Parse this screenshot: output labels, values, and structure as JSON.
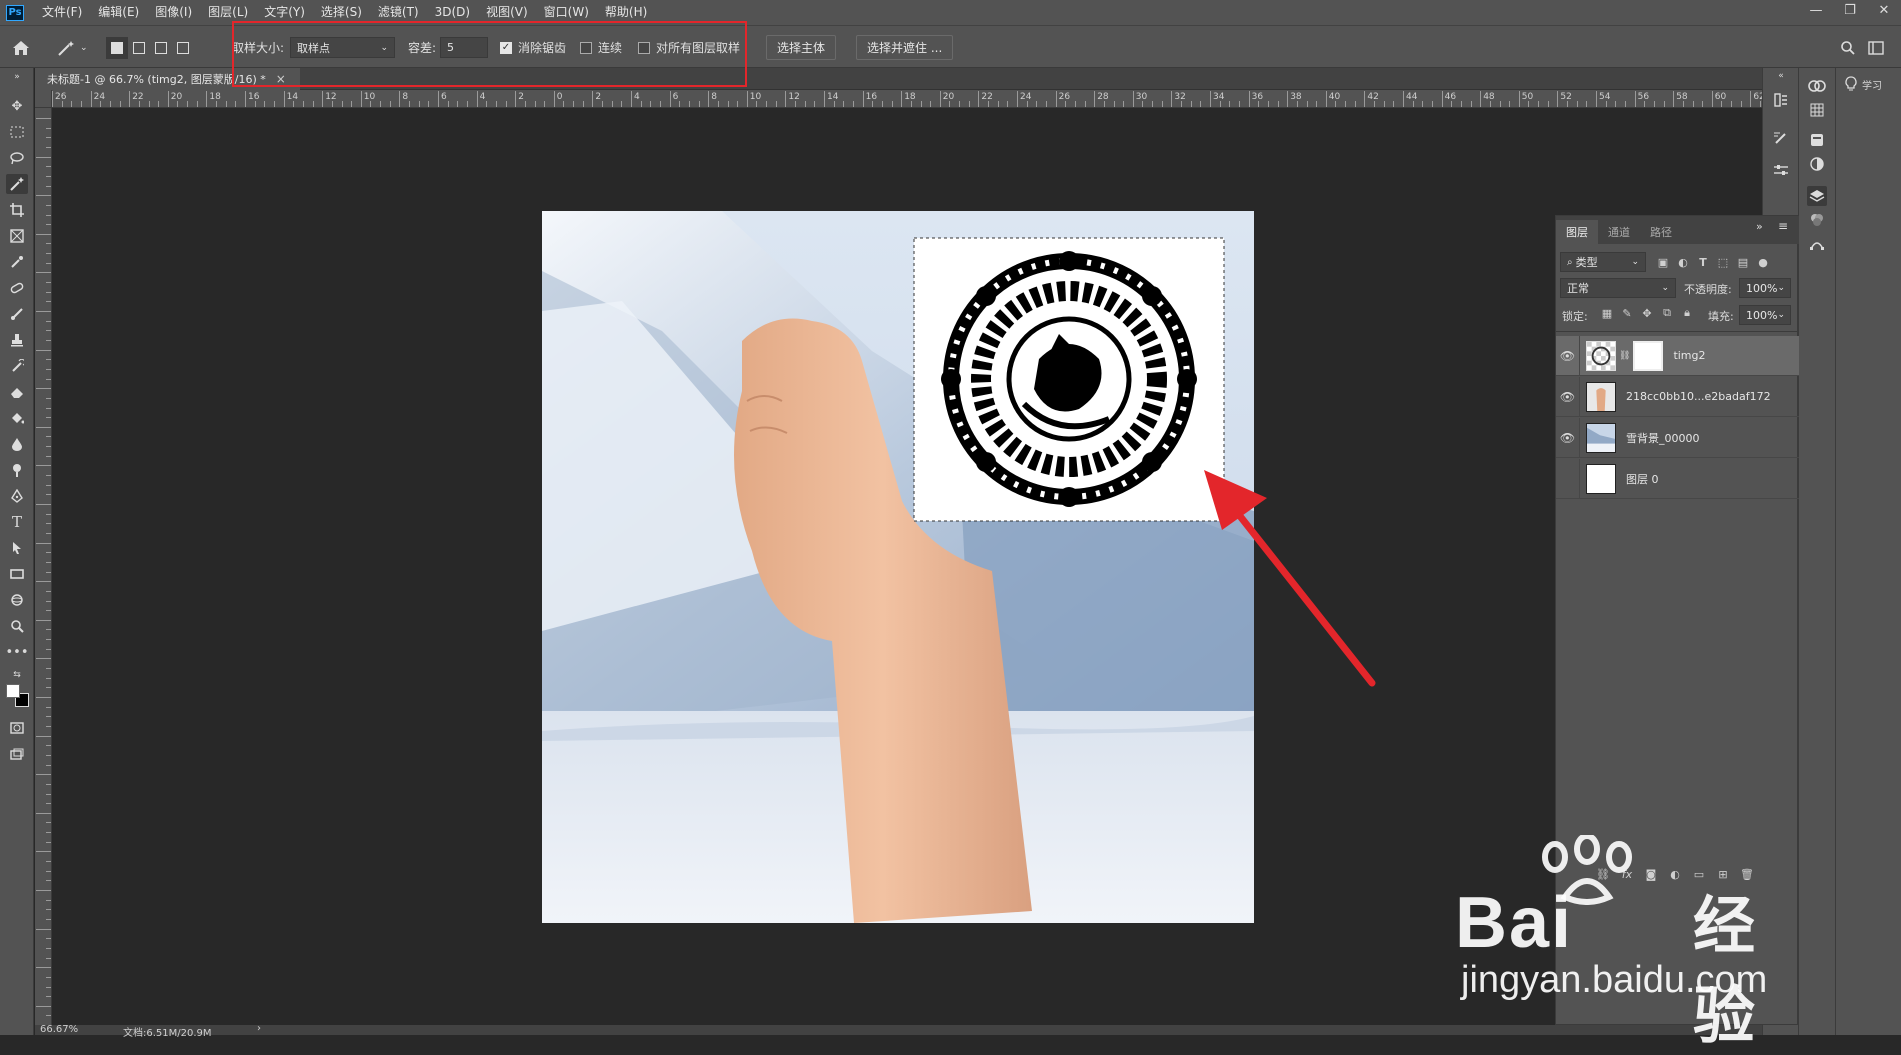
{
  "app": {
    "logo": "Ps"
  },
  "menu": [
    "文件(F)",
    "编辑(E)",
    "图像(I)",
    "图层(L)",
    "文字(Y)",
    "选择(S)",
    "滤镜(T)",
    "3D(D)",
    "视图(V)",
    "窗口(W)",
    "帮助(H)"
  ],
  "window_controls": [
    "—",
    "❐",
    "✕"
  ],
  "options": {
    "sample_size_label": "取样大小:",
    "sample_size_value": "取样点",
    "tolerance_label": "容差:",
    "tolerance_value": "5",
    "antialias_label": "消除锯齿",
    "antialias_checked": true,
    "contiguous_label": "连续",
    "contiguous_checked": false,
    "all_layers_label": "对所有图层取样",
    "all_layers_checked": false,
    "select_subject_label": "选择主体",
    "select_mask_label": "选择并遮住 ..."
  },
  "document": {
    "tab_title": "未标题-1 @ 66.7% (timg2, 图层蒙版/16) *",
    "tab_close": "×"
  },
  "ruler_labels": [
    "26",
    "24",
    "22",
    "20",
    "18",
    "16",
    "14",
    "12",
    "10",
    "8",
    "6",
    "4",
    "2",
    "0",
    "2",
    "4",
    "6",
    "8",
    "10",
    "12",
    "14",
    "16",
    "18",
    "20",
    "22",
    "24",
    "26",
    "28",
    "30",
    "32",
    "34",
    "36",
    "38",
    "40",
    "42",
    "44",
    "46",
    "48",
    "50",
    "52",
    "54",
    "56",
    "58",
    "60",
    "62"
  ],
  "status": {
    "zoom": "66.67%",
    "doc_size": "文档:6.51M/20.9M",
    "arrow": "›"
  },
  "layers_panel": {
    "tabs": [
      "图层",
      "通道",
      "路径"
    ],
    "filter_kind": "类型",
    "blend_mode": "正常",
    "opacity_label": "不透明度:",
    "opacity_value": "100%",
    "lock_label": "锁定:",
    "fill_label": "填充:",
    "fill_value": "100%",
    "layers": [
      {
        "name": "timg2",
        "visible": true,
        "selected": true
      },
      {
        "name": "218cc0bb10...e2badaf172",
        "visible": true,
        "selected": false
      },
      {
        "name": "雪背景_00000",
        "visible": true,
        "selected": false
      },
      {
        "name": "图层 0",
        "visible": false,
        "selected": false
      }
    ]
  },
  "learn_panel_label": "学习",
  "watermark": {
    "brand": "Bai",
    "brand2": "经验",
    "url": "jingyan.baidu.com"
  },
  "colors": {
    "annotation_red": "#e3262b",
    "ui_bg": "#535353",
    "canvas_bg": "#282828"
  }
}
